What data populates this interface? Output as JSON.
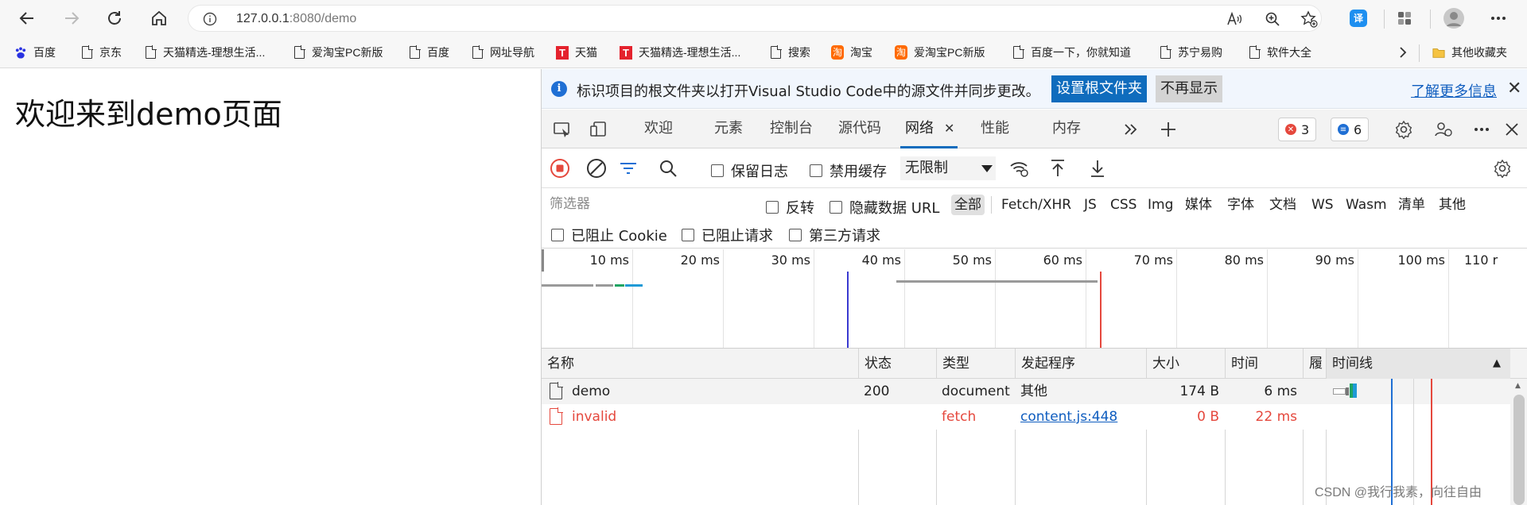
{
  "browser": {
    "url_host": "127.0.0.1",
    "url_rest": ":8080/demo",
    "read_aloud": "Aᵀ"
  },
  "bookmarks": [
    {
      "label": "百度",
      "icon": "baidu-paw-icon"
    },
    {
      "label": "京东",
      "icon": "page-icon"
    },
    {
      "label": "天猫精选-理想生活...",
      "icon": "page-icon"
    },
    {
      "label": "爱淘宝PC新版",
      "icon": "page-icon"
    },
    {
      "label": "百度",
      "icon": "page-icon"
    },
    {
      "label": "网址导航",
      "icon": "page-icon"
    },
    {
      "label": "天猫",
      "icon": "tmall-icon"
    },
    {
      "label": "天猫精选-理想生活...",
      "icon": "tmall-icon"
    },
    {
      "label": "搜索",
      "icon": "page-icon"
    },
    {
      "label": "淘宝",
      "icon": "taobao-icon"
    },
    {
      "label": "爱淘宝PC新版",
      "icon": "taobao-icon"
    },
    {
      "label": "百度一下，你就知道",
      "icon": "page-icon"
    },
    {
      "label": "苏宁易购",
      "icon": "page-icon"
    },
    {
      "label": "软件大全",
      "icon": "page-icon"
    }
  ],
  "bookmarks_other": "其他收藏夹",
  "page": {
    "title": "欢迎来到demo页面"
  },
  "devtools": {
    "infobar": {
      "message": "标识项目的根文件夹以打开Visual Studio Code中的源文件并同步更改。",
      "set_root": "设置根文件夹",
      "dont_show": "不再显示",
      "learn_more": "了解更多信息"
    },
    "tabs": [
      "欢迎",
      "元素",
      "控制台",
      "源代码",
      "网络",
      "性能",
      "内存"
    ],
    "active_tab": "网络",
    "errors_count": "3",
    "messages_count": "6",
    "toolbar": {
      "preserve_log": "保留日志",
      "disable_cache": "禁用缓存",
      "throttling": "无限制"
    },
    "filter": {
      "placeholder": "筛选器",
      "invert": "反转",
      "hide_data_urls": "隐藏数据 URL",
      "types": [
        "全部",
        "Fetch/XHR",
        "JS",
        "CSS",
        "Img",
        "媒体",
        "字体",
        "文档",
        "WS",
        "Wasm",
        "清单",
        "其他"
      ],
      "selected_type": "全部",
      "blocked_cookies": "已阻止 Cookie",
      "blocked_requests": "已阻止请求",
      "third_party": "第三方请求"
    },
    "overview_ticks": [
      "10 ms",
      "20 ms",
      "30 ms",
      "40 ms",
      "50 ms",
      "60 ms",
      "70 ms",
      "80 ms",
      "90 ms",
      "100 ms",
      "110 r"
    ],
    "table": {
      "headers": [
        "名称",
        "状态",
        "类型",
        "发起程序",
        "大小",
        "时间",
        "履",
        "时间线"
      ],
      "rows": [
        {
          "name": "demo",
          "status": "200",
          "type": "document",
          "initiator": "其他",
          "size": "174 B",
          "time": "6 ms",
          "error": false
        },
        {
          "name": "invalid",
          "status": "",
          "type": "fetch",
          "initiator": "content.js:448",
          "size": "0 B",
          "time": "22 ms",
          "error": true
        }
      ]
    }
  },
  "colors": {
    "accent": "#0f6cbd",
    "error": "#e5483d",
    "link": "#0f5dbf"
  },
  "watermark": "CSDN @我行我素，向往自由"
}
